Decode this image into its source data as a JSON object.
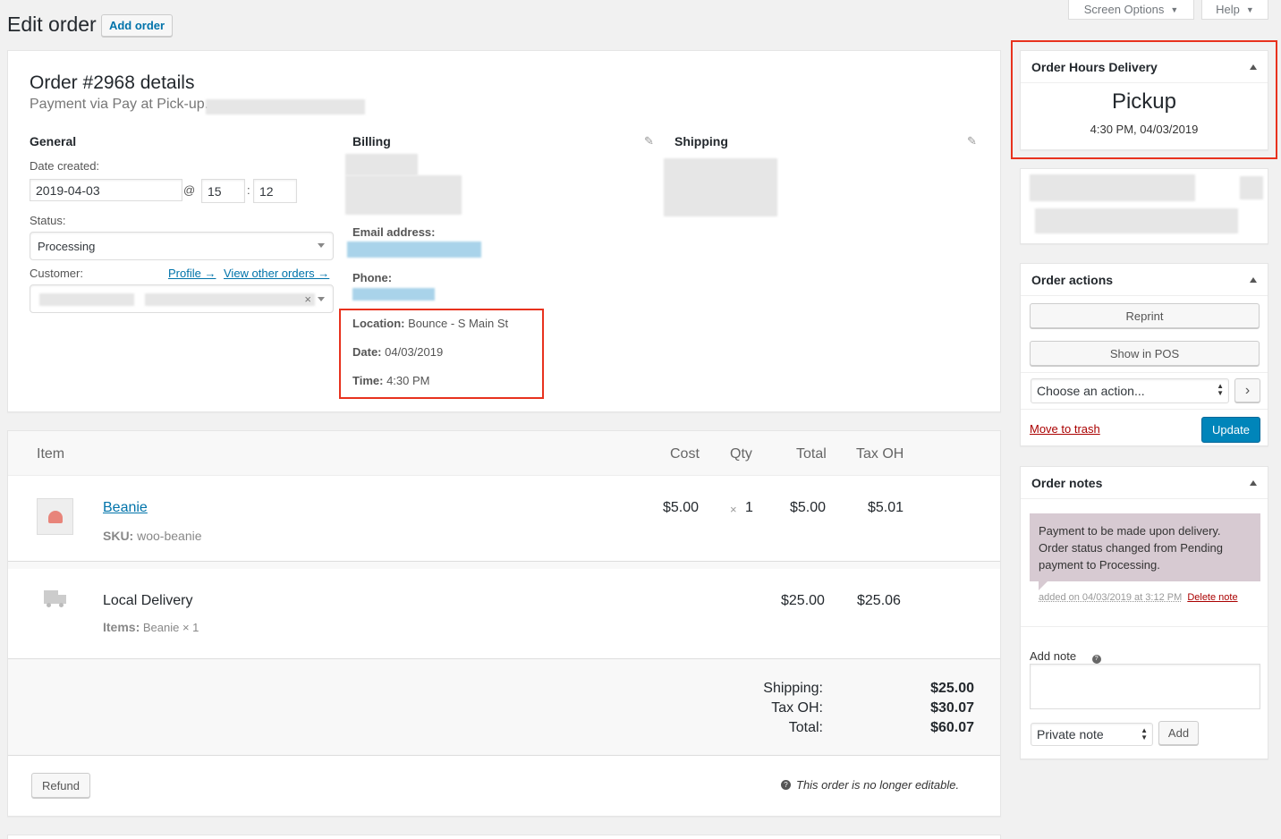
{
  "header": {
    "title": "Edit order",
    "add_order": "Add order",
    "screen_options": "Screen Options",
    "help": "Help"
  },
  "order": {
    "title": "Order #2968 details",
    "payment": "Payment via Pay at Pick-up.",
    "general": {
      "heading": "General",
      "date_created_label": "Date created:",
      "date": "2019-04-03",
      "at": "@",
      "hour": "15",
      "colon": ":",
      "minute": "12",
      "status_label": "Status:",
      "status": "Processing",
      "customer_label": "Customer:",
      "profile_link": "Profile →",
      "view_other_orders": "View other orders →",
      "clear": "×"
    },
    "billing": {
      "heading": "Billing",
      "email_label": "Email address:",
      "phone_label": "Phone:",
      "location_label": "Location:",
      "location": "Bounce - S Main St",
      "date_label": "Date:",
      "date": "04/03/2019",
      "time_label": "Time:",
      "time": "4:30 PM"
    },
    "shipping": {
      "heading": "Shipping"
    }
  },
  "items": {
    "columns": [
      "Item",
      "Cost",
      "Qty",
      "Total",
      "Tax OH"
    ],
    "product": {
      "name": "Beanie",
      "sku_label": "SKU:",
      "sku": "woo-beanie",
      "cost": "$5.00",
      "qty_x": "×",
      "qty": "1",
      "total": "$5.00",
      "tax": "$5.01"
    },
    "shipping_line": {
      "name": "Local Delivery",
      "items_label": "Items:",
      "items": "Beanie × 1",
      "total": "$25.00",
      "tax": "$25.06"
    },
    "totals": [
      {
        "label": "Shipping:",
        "value": "$25.00"
      },
      {
        "label": "Tax OH:",
        "value": "$30.07"
      },
      {
        "label": "Total:",
        "value": "$60.07"
      }
    ],
    "refund": "Refund",
    "not_editable": "This order is no longer editable."
  },
  "delivery_box": {
    "title": "Order Hours Delivery",
    "type": "Pickup",
    "when": "4:30 PM, 04/03/2019"
  },
  "order_actions": {
    "title": "Order actions",
    "reprint": "Reprint",
    "show_in_pos": "Show in POS",
    "choose": "Choose an action...",
    "go": "›",
    "trash": "Move to trash",
    "update": "Update"
  },
  "order_notes": {
    "title": "Order notes",
    "note_text": "Payment to be made upon delivery. Order status changed from Pending payment to Processing.",
    "added": "added on 04/03/2019 at 3:12 PM",
    "delete": "Delete note",
    "add_note_label": "Add note",
    "note_type": "Private note",
    "add": "Add"
  },
  "colors": {
    "highlight": "#e8321e",
    "primary": "#0085ba",
    "note_bg": "#d7cad2",
    "trash": "#a00"
  }
}
